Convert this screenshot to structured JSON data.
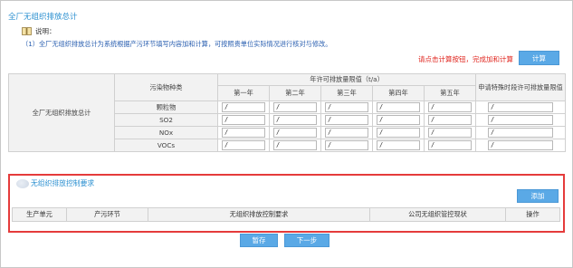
{
  "section1": {
    "title": "全厂无组织排放总计",
    "note_label": "说明：",
    "note_text": "（1）全厂无组织排放总计为系统根据产污环节填写内容加和计算，可按照贵单位实际情况进行核对与修改。",
    "hint": "请点击计算按钮，完成加和计算",
    "calc_button": "计算"
  },
  "table": {
    "row_header": "全厂无组织排放总计",
    "pollutant_header": "污染物种类",
    "limit_header": "年许可排放量限值（t/a）",
    "years": [
      "第一年",
      "第二年",
      "第三年",
      "第四年",
      "第五年"
    ],
    "special_header": "申请特殊时段许可排放量限值",
    "pollutants": [
      "颗粒物",
      "SO2",
      "NOx",
      "VOCs"
    ],
    "cell_value": "/"
  },
  "section2": {
    "title": "无组织排放控制要求",
    "add_button": "添加",
    "columns": [
      "生产单元",
      "产污环节",
      "无组织排放控制要求",
      "公司无组织管控现状",
      "操作"
    ]
  },
  "footer": {
    "save_button": "暂存",
    "next_button": "下一步"
  },
  "colors": {
    "title_blue": "#2a8fd0",
    "button_blue": "#5aa9e6",
    "hint_red": "#e0261f",
    "highlight_red": "#e53b3b"
  },
  "icons": {
    "note": "book-icon"
  }
}
